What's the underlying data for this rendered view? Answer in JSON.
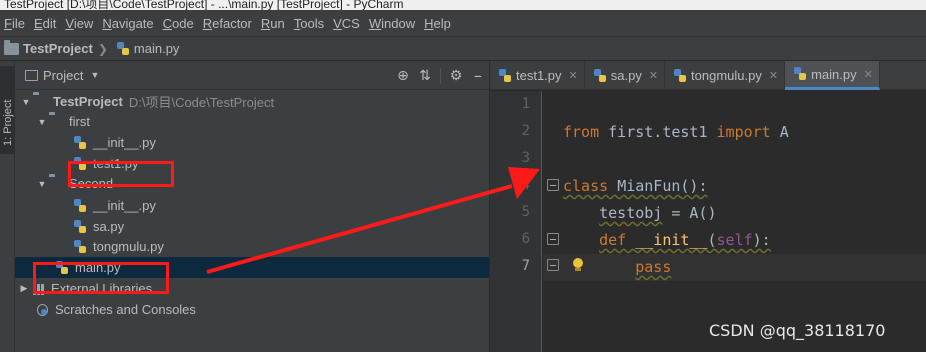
{
  "window": {
    "title": "TestProject [D:\\项目\\Code\\TestProject] - ...\\main.py [TestProject] - PyCharm"
  },
  "menu": [
    {
      "u": "F",
      "rest": "ile"
    },
    {
      "u": "E",
      "rest": "dit"
    },
    {
      "u": "V",
      "rest": "iew"
    },
    {
      "u": "N",
      "rest": "avigate"
    },
    {
      "u": "C",
      "rest": "ode"
    },
    {
      "u": "R",
      "rest": "efactor"
    },
    {
      "u": "R",
      "rest": "un"
    },
    {
      "u": "T",
      "rest": "ools"
    },
    {
      "u": "V",
      "rest": "CS"
    },
    {
      "u": "W",
      "rest": "indow"
    },
    {
      "u": "H",
      "rest": "elp"
    }
  ],
  "breadcrumb": {
    "project": "TestProject",
    "file": "main.py"
  },
  "side_tab": "1: Project",
  "project_panel": {
    "title": "Project",
    "root": {
      "name": "TestProject",
      "path": "D:\\项目\\Code\\TestProject"
    },
    "first": "first",
    "first_init": "__init__.py",
    "first_test1": "test1.py",
    "second": "Second",
    "second_init": "__init__.py",
    "second_sa": "sa.py",
    "second_tongmulu": "tongmulu.py",
    "main": "main.py",
    "external": "External Libraries",
    "scratches": "Scratches and Consoles"
  },
  "tabs": [
    {
      "label": "test1.py",
      "active": false
    },
    {
      "label": "sa.py",
      "active": false
    },
    {
      "label": "tongmulu.py",
      "active": false
    },
    {
      "label": "main.py",
      "active": true
    }
  ],
  "line_numbers": [
    "1",
    "2",
    "3",
    "4",
    "5",
    "6",
    "7"
  ],
  "code": {
    "l2_kw1": "from",
    "l2_mod": " first.test1 ",
    "l2_kw2": "import",
    "l2_name": " A",
    "l4_kw": "class",
    "l4_name": "MianFun",
    "l4_rest": "():",
    "l5_var": "testobj",
    "l5_rest": " = A()",
    "l6_kw": "def",
    "l6_fn": "__init__",
    "l6_p1": "(",
    "l6_self": "self",
    "l6_p2": "):",
    "l7_kw": "pass"
  },
  "watermark": "CSDN @qq_38118170",
  "colors": {
    "annotation": "#ff1a1a",
    "keyword": "#cc7832",
    "function": "#ffc66d",
    "self": "#94558d"
  }
}
